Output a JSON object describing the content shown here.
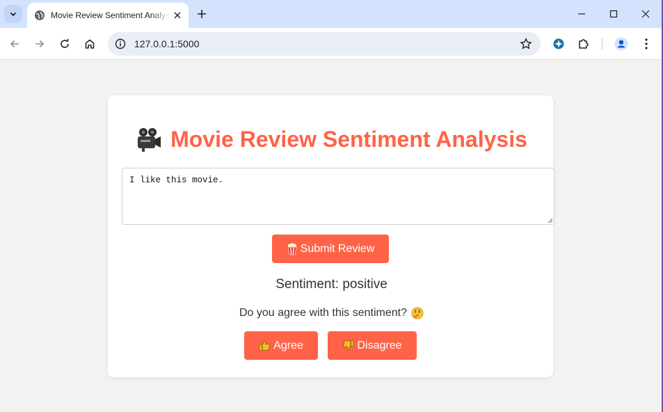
{
  "browser": {
    "tab_title": "Movie Review Sentiment Analysis",
    "url": "127.0.0.1:5000"
  },
  "page": {
    "heading": "Movie Review Sentiment Analysis",
    "review_text": "I like this movie.",
    "submit_label": "Submit Review",
    "sentiment_text": "Sentiment: positive",
    "agree_question": "Do you agree with this sentiment?",
    "agree_label": "Agree",
    "disagree_label": "Disagree"
  },
  "colors": {
    "accent": "#ff6347",
    "page_background": "#f2f2f2",
    "tabstrip": "#d3e3fd"
  },
  "icons": {
    "heading": "movie-camera-icon",
    "submit": "popcorn-icon",
    "question": "thinking-face-icon",
    "agree": "thumbs-up-icon",
    "disagree": "thumbs-down-icon"
  }
}
